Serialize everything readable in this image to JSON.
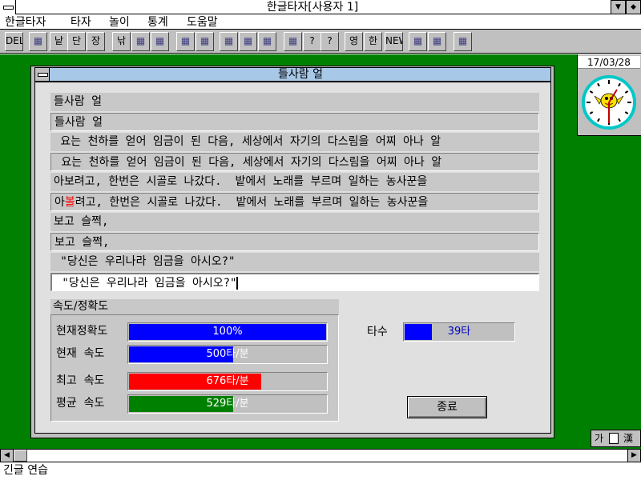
{
  "app": {
    "title": "한글타자[사용자 1]"
  },
  "menu": [
    "한글타자",
    "타자",
    "놀이",
    "통계",
    "도움말"
  ],
  "toolbar": {
    "buttons": [
      {
        "name": "del-ins-toggle-button",
        "label": "DEL INS",
        "icon": "del-ins-icon"
      },
      {
        "name": "key-practice-button",
        "label": "",
        "icon": "keyboard-icon"
      },
      {
        "name": "word-practice-button",
        "label": "낱말",
        "icon": "word-icon"
      },
      {
        "name": "short-text-button",
        "label": "단문",
        "icon": "short-text-icon"
      },
      {
        "name": "long-text-button",
        "label": "장문",
        "icon": "long-text-icon"
      },
      {
        "name": "fishing-game-button",
        "label": "낚시",
        "icon": "fishing-icon"
      },
      {
        "name": "game2-button",
        "label": "",
        "icon": "game-icon"
      },
      {
        "name": "game3-button",
        "label": "",
        "icon": "game-icon"
      },
      {
        "name": "target-button",
        "label": "",
        "icon": "target-icon"
      },
      {
        "name": "rain-button",
        "label": "",
        "icon": "drop-icon"
      },
      {
        "name": "keyboard-stat-button",
        "label": "",
        "icon": "keyboard-icon"
      },
      {
        "name": "graph-button",
        "label": "",
        "icon": "graph-icon"
      },
      {
        "name": "stat-button",
        "label": "",
        "icon": "stat-icon"
      },
      {
        "name": "replay-button",
        "label": "",
        "icon": "replay-icon"
      },
      {
        "name": "help-button",
        "label": "?",
        "icon": "question-icon"
      },
      {
        "name": "context-help-button",
        "label": "?",
        "icon": "question-icon"
      },
      {
        "name": "kor-eng-button",
        "label": "영한",
        "icon": "kor-eng-icon"
      },
      {
        "name": "han-eng-button",
        "label": "한영",
        "icon": "han-eng-icon"
      },
      {
        "name": "new-eng-button",
        "label": "NEW 영",
        "icon": "new-icon"
      },
      {
        "name": "music-button",
        "label": "",
        "icon": "music-icon"
      },
      {
        "name": "mute-button",
        "label": "",
        "icon": "mute-icon"
      },
      {
        "name": "exit-door-button",
        "label": "",
        "icon": "door-icon"
      }
    ]
  },
  "clock": {
    "date": "17/03/28"
  },
  "window": {
    "title": "들사람 얼"
  },
  "practice": {
    "pairs": [
      {
        "source": "들사람 얼",
        "typed": "들사람 얼"
      },
      {
        "source": " 요는 천하를 얻어 임금이 된 다음, 세상에서 자기의 다스림을 어찌 아나 알",
        "typed": " 요는 천하를 얻어 임금이 된 다음, 세상에서 자기의 다스림을 어찌 아나 알"
      },
      {
        "source": "아보려고, 한번은 시골로 나갔다.  밭에서 노래를 부르며 일하는 농사꾼을",
        "typed_pre": "아",
        "typed_err": "볼",
        "typed_post": "려고, 한번은 시골로 나갔다.  밭에서 노래를 부르며 일하는 농사꾼을"
      },
      {
        "source": "보고 슬쩍,",
        "typed": "보고 슬쩍,"
      },
      {
        "source": " \"당신은 우리나라 임금을 아시오?\"",
        "typed": " \"당신은 우리나라 임금을 아시오?\""
      }
    ]
  },
  "stats": {
    "group_title": "속도/정확도",
    "accuracy": {
      "label": "현재정확도",
      "text": "100%",
      "fraction": 1.0
    },
    "current_speed": {
      "label": "현재  속도",
      "text": "500타/분",
      "fraction": 0.53
    },
    "max_speed": {
      "label": "최고  속도",
      "text": "676타/분",
      "fraction": 0.67
    },
    "avg_speed": {
      "label": "평균  속도",
      "text": "529타/분",
      "fraction": 0.53
    },
    "keystrokes": {
      "label": "타수",
      "text": "39타",
      "fraction": 0.25
    }
  },
  "colors": {
    "accuracy": "#0000ff",
    "current_speed": "#0000ff",
    "max_speed": "#ff0000",
    "avg_speed": "#008000",
    "desktop": "#008000"
  },
  "end_button": "종료",
  "ime": {
    "a": "가",
    "b": "漢"
  },
  "status": "긴글 연습"
}
